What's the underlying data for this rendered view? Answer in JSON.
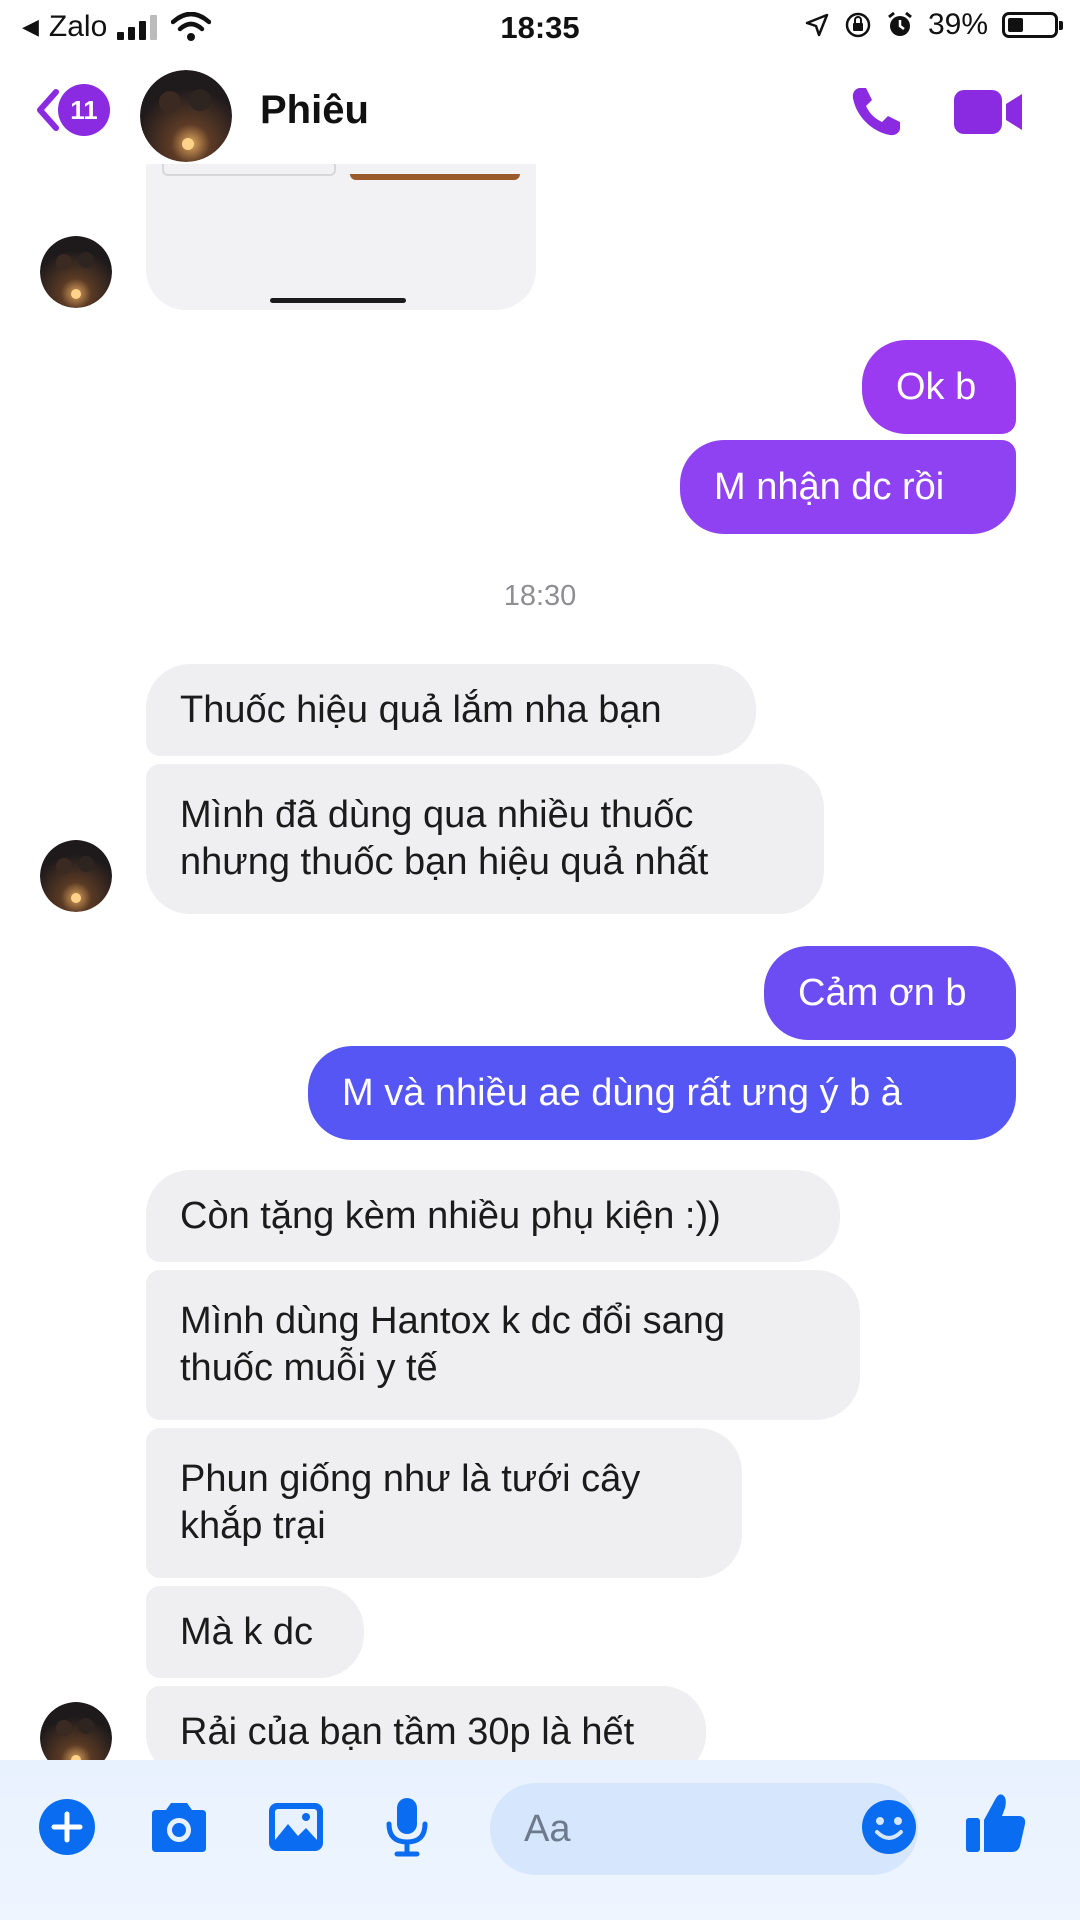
{
  "status_bar": {
    "back_app": "Zalo",
    "time": "18:35",
    "battery": "39%"
  },
  "header": {
    "unread_count": "11",
    "contact_name": "Phiêu"
  },
  "colors": {
    "accent": "#8a2be2",
    "out_bubble_top": "#9b3cf0",
    "out_bubble_bottom": "#4f5cf5",
    "incoming_bubble": "#efeff1",
    "composer_blue": "#0a6cf1"
  },
  "messages": {
    "out1": "Ok b",
    "out2": "M nhận dc rồi",
    "timestamp": "18:30",
    "in1": "Thuốc hiệu quả lắm nha bạn",
    "in2_line1": "Mình đã dùng qua nhiều thuốc",
    "in2_line2": "nhưng thuốc bạn hiệu quả nhất",
    "out3": "Cảm ơn b",
    "out4": "M và nhiều ae dùng rất ưng ý b à",
    "in3": "Còn tặng kèm nhiều phụ kiện :))",
    "in4_line1": "Mình dùng Hantox k dc đổi sang",
    "in4_line2": "thuốc muỗi y tế",
    "in5_line1": "Phun giống như là tưới cây",
    "in5_line2": "khắp trại",
    "in6": "Mà k dc",
    "in7": "Rải của bạn tầm 30p là hết"
  },
  "composer": {
    "placeholder": "Aa"
  },
  "icons": [
    "back-chevron-icon",
    "phone-icon",
    "video-camera-icon",
    "plus-icon",
    "camera-icon",
    "gallery-icon",
    "microphone-icon",
    "emoji-icon",
    "thumbs-up-icon"
  ]
}
